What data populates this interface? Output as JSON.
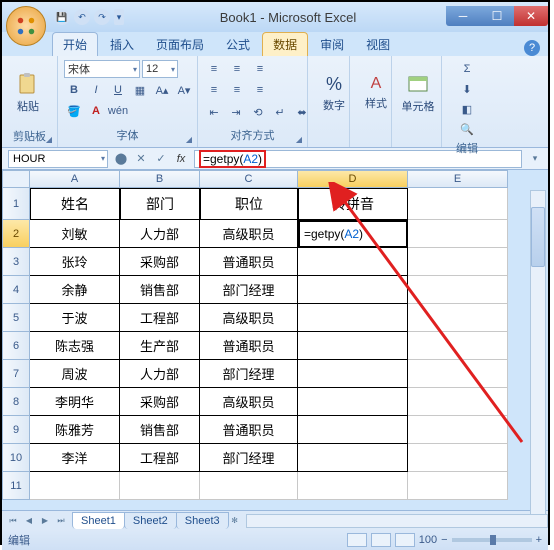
{
  "title": "Book1 - Microsoft Excel",
  "tabs": {
    "home": "开始",
    "insert": "插入",
    "pagelayout": "页面布局",
    "formulas": "公式",
    "data": "数据",
    "review": "审阅",
    "view": "视图"
  },
  "ribbon": {
    "clipboard": {
      "paste": "粘贴",
      "label": "剪贴板"
    },
    "font": {
      "name": "宋体",
      "size": "12",
      "label": "字体"
    },
    "align": {
      "label": "对齐方式"
    },
    "number": {
      "btn": "数字",
      "label": ""
    },
    "styles": {
      "btn": "样式",
      "label": ""
    },
    "cells": {
      "btn": "单元格",
      "label": ""
    },
    "editing": {
      "label": "编辑"
    }
  },
  "namebox": "HOUR",
  "formula": {
    "text": "=getpy(",
    "ref": "A2",
    "close": ")"
  },
  "cols": [
    "A",
    "B",
    "C",
    "D",
    "E"
  ],
  "headers": {
    "A": "姓名",
    "B": "部门",
    "C": "职位",
    "D": "转拼音"
  },
  "table": [
    {
      "A": "刘敏",
      "B": "人力部",
      "C": "高级职员"
    },
    {
      "A": "张玲",
      "B": "采购部",
      "C": "普通职员"
    },
    {
      "A": "余静",
      "B": "销售部",
      "C": "部门经理"
    },
    {
      "A": "于波",
      "B": "工程部",
      "C": "高级职员"
    },
    {
      "A": "陈志强",
      "B": "生产部",
      "C": "普通职员"
    },
    {
      "A": "周波",
      "B": "人力部",
      "C": "部门经理"
    },
    {
      "A": "李明华",
      "B": "采购部",
      "C": "高级职员"
    },
    {
      "A": "陈雅芳",
      "B": "销售部",
      "C": "普通职员"
    },
    {
      "A": "李洋",
      "B": "工程部",
      "C": "部门经理"
    }
  ],
  "active_cell_display": {
    "prefix": "=getpy(",
    "ref": "A2",
    "suffix": ")"
  },
  "sheets": [
    "Sheet1",
    "Sheet2",
    "Sheet3"
  ],
  "status": "编辑",
  "zoom": "100"
}
